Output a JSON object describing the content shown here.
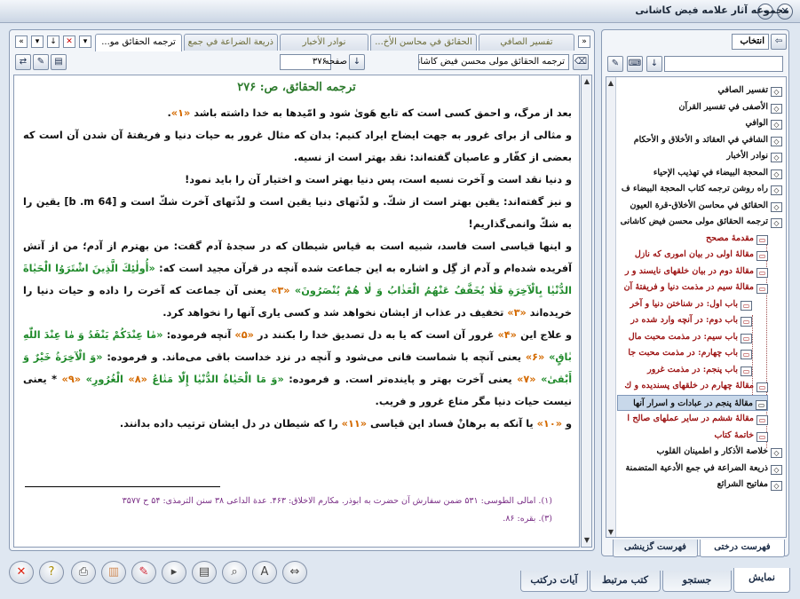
{
  "window": {
    "title": "مجموعه آثار علامه فیض کاشانی"
  },
  "tabs": [
    {
      "label": "ترجمه الحقائق مو...",
      "active": true
    },
    {
      "label": "ذريعة الضراعة في جمع ..."
    },
    {
      "label": "نوادر الأخبار"
    },
    {
      "label": "الحقائق في محاسن الأخ..."
    },
    {
      "label": "تفسير الصافي"
    }
  ],
  "toolbar": {
    "book_name": "ترجمه الحقائق مولی محسن فیض کاشانی",
    "page_label": "صفحه",
    "page_value": "۳۷۶"
  },
  "content": {
    "heading": "ترجمه الحقائق، ص: ۲۷۶",
    "lines": [
      [
        [
          "بعد از مرگ، و احمق كسى است كه تابع هَوىٰ شود و امّيدها به خدا داشته باشد ",
          ""
        ],
        [
          "«۱»",
          "o"
        ],
        [
          ".",
          ""
        ]
      ],
      [
        [
          "و مثالى از براى غرور به جهت ايضاح ايراد كنيم: بدان كه مثال غرور به حيات دنيا و فريفتهٔ آن شدن آن است كه بعضى از كفّار و عاصيان گفته‌اند: نقد بهتر است از نسيه.",
          ""
        ]
      ],
      [
        [
          "و دنيا نقد است و آخرت نسيه است، پس دنيا بهتر است و اختيار آن را بايد نمود!",
          ""
        ]
      ],
      [
        [
          "و نيز گفته‌اند: يقين بهتر است از شكّ. و لذّتهاى دنيا يقين است و لذّتهاى آخرت شكّ است و [64 b .m] يقين را به شكّ وانمى‌گذاريم!",
          ""
        ]
      ],
      [
        [
          "و اينها قياسى است فاسد، شبيه است به قياس شيطان كه در سجدهٔ آدم گفت: من بهترم از آدم؛ من از آتش آفريده شده‌ام و آدم از گِل و اشاره به اين جماعت شده آنچه در قرآن مجيد است كه: ",
          ""
        ],
        [
          "«أُولٰئِكَ الَّذِينَ اشْتَرَوُا الْحَيٰاةَ الدُّنْيٰا بِالْآخِرَةِ فَلٰا يُخَفَّفُ عَنْهُمُ الْعَذٰابُ وَ لٰا هُمْ يُنْصَرُونَ»",
          "g"
        ],
        [
          " «۳» ",
          "o"
        ],
        [
          "يعنى آن جماعت كه آخرت را داده و حيات دنيا را خريده‌اند ",
          ""
        ],
        [
          "«۳»",
          "o"
        ],
        [
          " تخفيف در عذاب از ايشان نخواهد شد و كسى يارى آنها را نخواهد كرد.",
          ""
        ]
      ],
      [
        [
          "و علاج اين ",
          ""
        ],
        [
          "«۴»",
          "o"
        ],
        [
          " غرور آن است كه يا به دل تصديق خدا را بكنند در ",
          ""
        ],
        [
          "«۵»",
          "o"
        ],
        [
          " آنچه فرموده: ",
          ""
        ],
        [
          "«مٰا عِنْدَكُمْ يَنْفَدُ وَ مٰا عِنْدَ اللّٰهِ بٰاقٍ»",
          "g"
        ],
        [
          " «۶» ",
          "o"
        ],
        [
          "يعنى آنچه با شماست فانى مى‌شود و آنچه در نزد خداست باقى مى‌ماند. و فرموده: ",
          ""
        ],
        [
          "«وَ الْآخِرَةُ خَيْرٌ وَ أَبْقىٰ»",
          "g"
        ],
        [
          " «۷» ",
          "o"
        ],
        [
          "يعنى آخرت بهتر و پاينده‌تر است. و فرموده: ",
          ""
        ],
        [
          "«وَ مَا الْحَيٰاةُ الدُّنْيٰا إِلّٰا مَتٰاعُ",
          "g"
        ],
        [
          " «۸» ",
          "o"
        ],
        [
          "الْغُرُورِ»",
          "g"
        ],
        [
          " «۹» ",
          "o"
        ],
        [
          "* يعنى نيست حيات دنيا مگر متاع غرور و فريب.",
          ""
        ]
      ],
      [
        [
          "و ",
          ""
        ],
        [
          "«۱۰»",
          "o"
        ],
        [
          " يا آنكه به برهانْ فساد اين قياسى ",
          ""
        ],
        [
          "«۱۱»",
          "o"
        ],
        [
          " را كه شيطان در دل ايشان ترتيب داده بدانند.",
          ""
        ]
      ]
    ],
    "footnotes": [
      "(۱). امالى الطوسى: ۵۳۱ ضمن سفارش آن حضرت به ابوذر. مكارم الاخلاق: ۴۶۳. عدة الداعى ۳۸ سنن الترمذى: ۵۴ ح ۳۵۷۷",
      "(۳). بقره: ۸۶."
    ]
  },
  "bottom_tabs": [
    {
      "label": "نمایش",
      "active": true
    },
    {
      "label": "جستجو"
    },
    {
      "label": "کتب مرتبط"
    },
    {
      "label": "آیات درکتب"
    }
  ],
  "right_panel": {
    "select_button": "انتخاب",
    "search_placeholder": "",
    "tree": [
      {
        "label": "تفسير الصافي",
        "level": 0
      },
      {
        "label": "الأصفى في تفسير القرآن",
        "level": 0
      },
      {
        "label": "الوافي",
        "level": 0
      },
      {
        "label": "الشافي في العقائد و الأخلاق و الأحكام",
        "level": 0
      },
      {
        "label": "نوادر الأخبار",
        "level": 0
      },
      {
        "label": "المحجة البيضاء في تهذيب الإحياء",
        "level": 0
      },
      {
        "label": "راه روشن ترجمه كتاب المحجة البيضاء ف",
        "level": 0
      },
      {
        "label": "الحقائق في محاسن الأخلاق-قرة العيون",
        "level": 0
      },
      {
        "label": "ترجمه الحقائق مولی محسن فیض کاشانی",
        "level": 0
      },
      {
        "label": "مقدمهٔ مصحح",
        "level": 1,
        "red": true
      },
      {
        "label": "مقالهٔ اولى در بيان امورى كه نازل",
        "level": 1,
        "red": true
      },
      {
        "label": "مقالهٔ دوم در بيان خلقهاى نايسند و ر",
        "level": 1,
        "red": true
      },
      {
        "label": "مقالهٔ سيم در مذمت دنيا و فريفتهٔ آن",
        "level": 1,
        "red": true
      },
      {
        "label": "باب اول: در شناختن دنيا و آخر",
        "level": 2,
        "red": true
      },
      {
        "label": "باب دوم: در آنچه وارد شده در",
        "level": 2,
        "red": true
      },
      {
        "label": "باب سيم: در مذمت محبت مال",
        "level": 2,
        "red": true
      },
      {
        "label": "باب چهارم: در مذمت محبت جا",
        "level": 2,
        "red": true
      },
      {
        "label": "باب پنجم: در مذمت غرور",
        "level": 2,
        "red": true
      },
      {
        "label": "مقالهٔ چهارم در خلقهاى پسنديده و ك",
        "level": 1,
        "red": true
      },
      {
        "label": "مقالهٔ پنجم در عبادات و اسرار آنها",
        "level": 1,
        "selected": true
      },
      {
        "label": "مقالهٔ ششم در ساير عملهاى صالح ا",
        "level": 1,
        "red": true
      },
      {
        "label": "خاتمهٔ كتاب",
        "level": 1,
        "red": true
      },
      {
        "label": "خلاصة الأذكار و اطمينان القلوب",
        "level": 0
      },
      {
        "label": "ذريعة الضراعة في جمع الأدعية المتضمنة",
        "level": 0
      },
      {
        "label": "مفاتيح الشرائع",
        "level": 0
      }
    ],
    "bottom_tabs": [
      {
        "label": "فهرست درختی",
        "active": true
      },
      {
        "label": "فهرست گزینشی"
      }
    ]
  }
}
